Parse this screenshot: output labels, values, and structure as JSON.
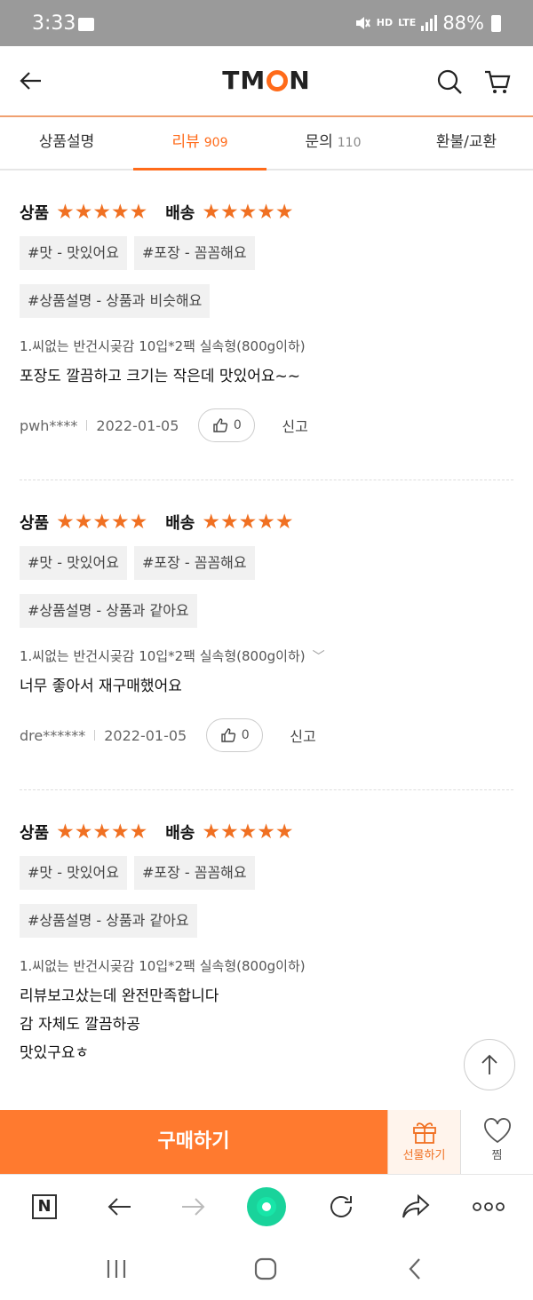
{
  "status": {
    "time": "3:33",
    "hd": "HD",
    "lte": "LTE",
    "battery": "88%"
  },
  "header": {
    "logo_left": "TM",
    "logo_right": "N"
  },
  "tabs": [
    {
      "label": "상품설명",
      "count": ""
    },
    {
      "label": "리뷰",
      "count": "909"
    },
    {
      "label": "문의",
      "count": "110"
    },
    {
      "label": "환불/교환",
      "count": ""
    }
  ],
  "labels": {
    "product": "상품",
    "delivery": "배송",
    "report": "신고",
    "stars": "★★★★★"
  },
  "reviews": [
    {
      "tags": [
        "#맛 - 맛있어요",
        "#포장 - 꼼꼼해요",
        "#상품설명 - 상품과 비슷해요"
      ],
      "option": "1.씨없는 반건시곶감 10입*2팩 실속형(800g이하)",
      "content": "포장도 깔끔하고 크기는 작은데 맛있어요~~",
      "user": "pwh****",
      "date": "2022-01-05",
      "likes": "0"
    },
    {
      "tags": [
        "#맛 - 맛있어요",
        "#포장 - 꼼꼼해요",
        "#상품설명 - 상품과 같아요"
      ],
      "option": "1.씨없는 반건시곶감 10입*2팩 실속형(800g이하)",
      "content": "너무 좋아서 재구매했어요",
      "user": "dre******",
      "date": "2022-01-05",
      "likes": "0"
    },
    {
      "tags": [
        "#맛 - 맛있어요",
        "#포장 - 꼼꼼해요",
        "#상품설명 - 상품과 같아요"
      ],
      "option": "1.씨없는 반건시곶감 10입*2팩 실속형(800g이하)",
      "content_lines": [
        "리뷰보고샀는데 완전만족합니다",
        "감 자체도 깔끔하공",
        "맛있구요ㅎ"
      ]
    }
  ],
  "bottom": {
    "buy": "구매하기",
    "gift": "선물하기",
    "zzim": "찜"
  },
  "browser": {
    "n_label": "N"
  },
  "colors": {
    "accent": "#ff6b1a",
    "buy": "#ff7a2f",
    "star": "#f07022"
  }
}
